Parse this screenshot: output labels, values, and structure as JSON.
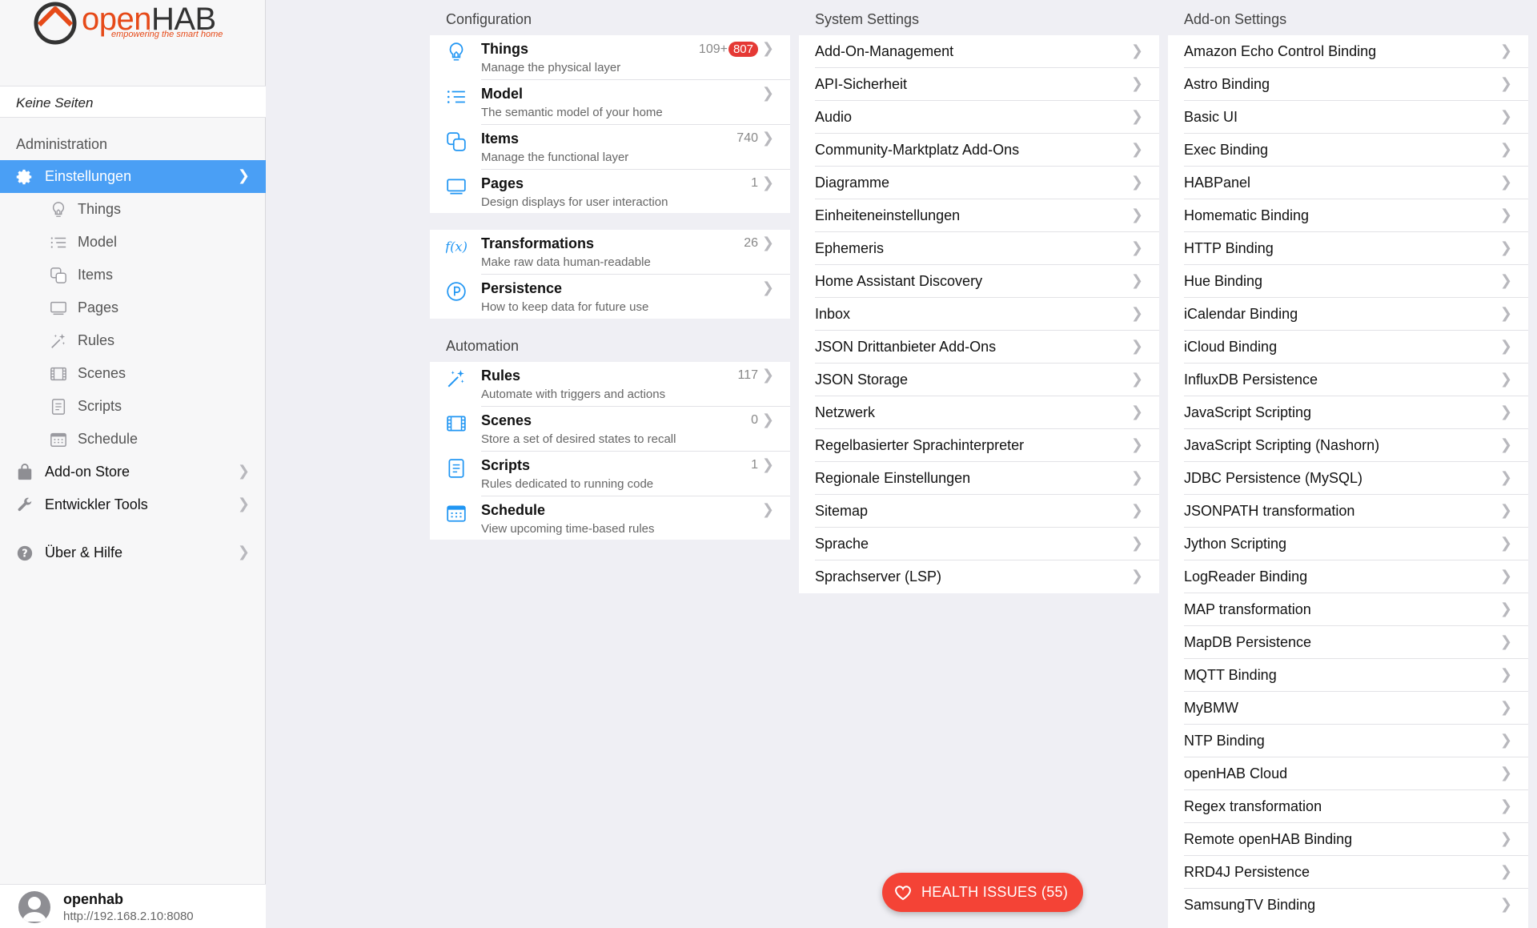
{
  "app": {
    "logo_main_o": "open",
    "logo_main_h": "HAB",
    "logo_tagline": "empowering the smart home"
  },
  "sidebar": {
    "pages_label": "Keine Seiten",
    "section_title": "Administration",
    "settings_label": "Einstellungen",
    "sub_items": [
      {
        "label": "Things",
        "icon": "lightbulb-icon"
      },
      {
        "label": "Model",
        "icon": "list-icon"
      },
      {
        "label": "Items",
        "icon": "squares-icon"
      },
      {
        "label": "Pages",
        "icon": "monitor-icon"
      },
      {
        "label": "Rules",
        "icon": "wand-icon"
      },
      {
        "label": "Scenes",
        "icon": "film-icon"
      },
      {
        "label": "Scripts",
        "icon": "document-icon"
      },
      {
        "label": "Schedule",
        "icon": "calendar-icon"
      }
    ],
    "addon_store_label": "Add-on Store",
    "dev_tools_label": "Entwickler Tools",
    "help_label": "Über & Hilfe",
    "user": {
      "name": "openhab",
      "url": "http://192.168.2.10:8080"
    }
  },
  "configuration": {
    "title": "Configuration",
    "group1": [
      {
        "title": "Things",
        "subtitle": "Manage the physical layer",
        "count": "109+",
        "badge": "807",
        "icon": "lightbulb-icon"
      },
      {
        "title": "Model",
        "subtitle": "The semantic model of your home",
        "count": "",
        "icon": "list-icon"
      },
      {
        "title": "Items",
        "subtitle": "Manage the functional layer",
        "count": "740",
        "icon": "squares-icon"
      },
      {
        "title": "Pages",
        "subtitle": "Design displays for user interaction",
        "count": "1",
        "icon": "monitor-icon"
      }
    ],
    "group2": [
      {
        "title": "Transformations",
        "subtitle": "Make raw data human-readable",
        "count": "26",
        "icon": "function-icon"
      },
      {
        "title": "Persistence",
        "subtitle": "How to keep data for future use",
        "count": "",
        "icon": "persistence-icon"
      }
    ]
  },
  "automation": {
    "title": "Automation",
    "items": [
      {
        "title": "Rules",
        "subtitle": "Automate with triggers and actions",
        "count": "117",
        "icon": "wand-icon"
      },
      {
        "title": "Scenes",
        "subtitle": "Store a set of desired states to recall",
        "count": "0",
        "icon": "film-icon"
      },
      {
        "title": "Scripts",
        "subtitle": "Rules dedicated to running code",
        "count": "1",
        "icon": "document-icon"
      },
      {
        "title": "Schedule",
        "subtitle": "View upcoming time-based rules",
        "count": "",
        "icon": "calendar-icon"
      }
    ]
  },
  "system_settings": {
    "title": "System Settings",
    "items": [
      "Add-On-Management",
      "API-Sicherheit",
      "Audio",
      "Community-Marktplatz Add-Ons",
      "Diagramme",
      "Einheiteneinstellungen",
      "Ephemeris",
      "Home Assistant Discovery",
      "Inbox",
      "JSON Drittanbieter Add-Ons",
      "JSON Storage",
      "Netzwerk",
      "Regelbasierter Sprachinterpreter",
      "Regionale Einstellungen",
      "Sitemap",
      "Sprache",
      "Sprachserver (LSP)"
    ]
  },
  "addon_settings": {
    "title": "Add-on Settings",
    "items": [
      "Amazon Echo Control Binding",
      "Astro Binding",
      "Basic UI",
      "Exec Binding",
      "HABPanel",
      "Homematic Binding",
      "HTTP Binding",
      "Hue Binding",
      "iCalendar Binding",
      "iCloud Binding",
      "InfluxDB Persistence",
      "JavaScript Scripting",
      "JavaScript Scripting (Nashorn)",
      "JDBC Persistence (MySQL)",
      "JSONPATH transformation",
      "Jython Scripting",
      "LogReader Binding",
      "MAP transformation",
      "MapDB Persistence",
      "MQTT Binding",
      "MyBMW",
      "NTP Binding",
      "openHAB Cloud",
      "Regex transformation",
      "Remote openHAB Binding",
      "RRD4J Persistence",
      "SamsungTV Binding"
    ]
  },
  "health": {
    "label": "HEALTH ISSUES (55)"
  },
  "colors": {
    "accent": "#4a9ff5",
    "icon_blue": "#2196f3",
    "badge_red": "#e53935",
    "health_red": "#f44336",
    "brand_orange": "#e64a19"
  }
}
